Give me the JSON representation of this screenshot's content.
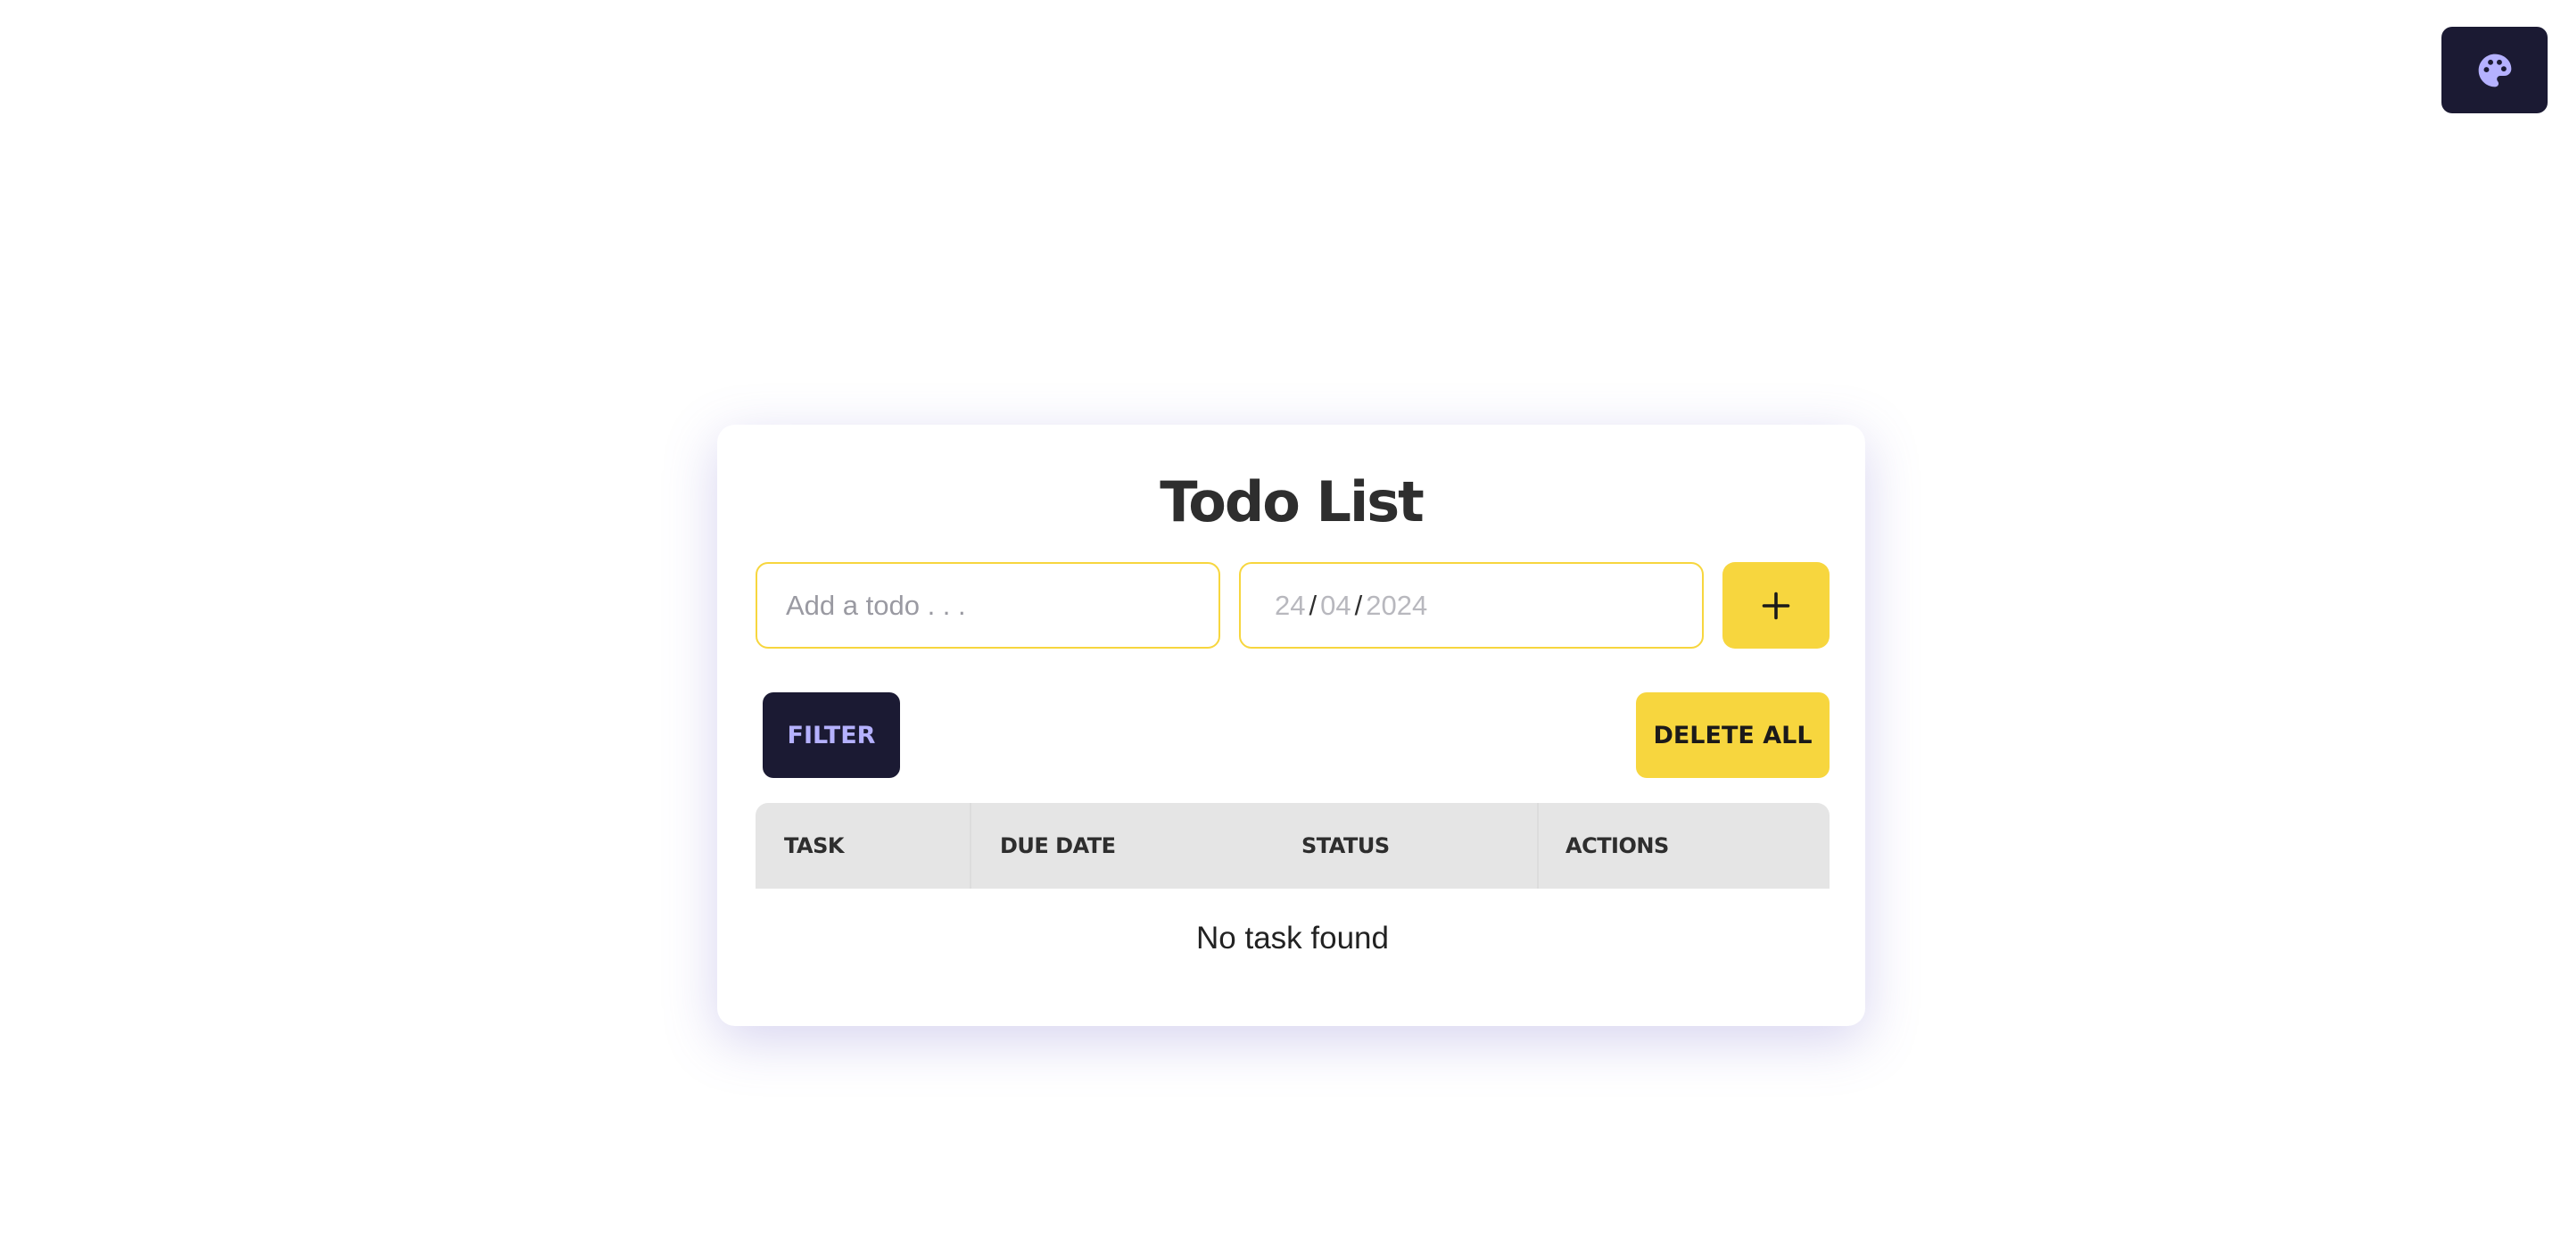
{
  "theme_toggle": {
    "icon": "palette-icon"
  },
  "todo_list": {
    "title": "Todo List",
    "todo_input": {
      "placeholder": "Add a todo . . .",
      "value": ""
    },
    "date_input": {
      "day": "24",
      "month": "04",
      "year": "2024",
      "separator": "/"
    },
    "add_button": {
      "icon": "plus-icon"
    },
    "filter_label": "FILTER",
    "delete_all_label": "DELETE ALL",
    "table": {
      "columns": [
        "TASK",
        "DUE DATE",
        "STATUS",
        "ACTIONS"
      ],
      "rows": [],
      "empty_message": "No task found"
    }
  },
  "colors": {
    "accent": "#f7d63e",
    "dark": "#1b1a33",
    "filter_text": "#b5b1ff",
    "header_bg": "#e5e5e5"
  }
}
